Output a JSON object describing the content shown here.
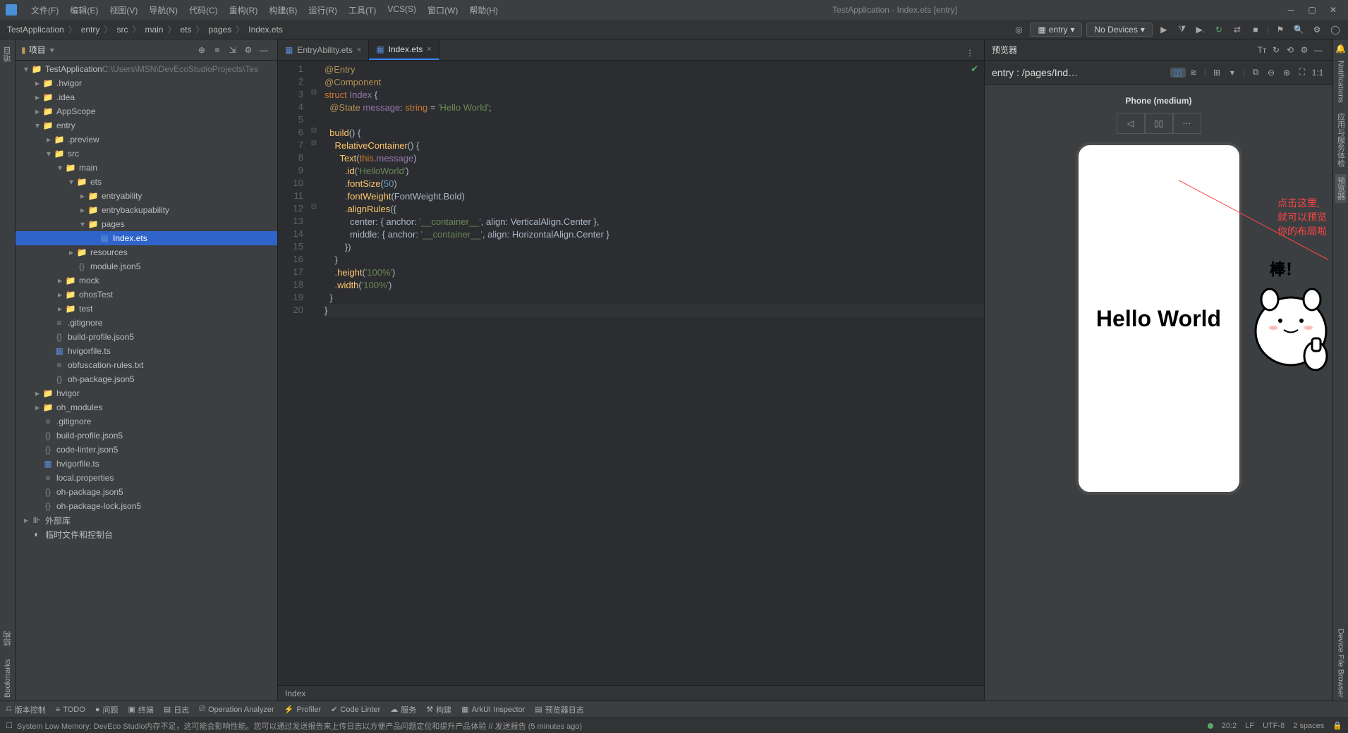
{
  "window": {
    "title": "TestApplication - Index.ets [entry]"
  },
  "menus": [
    "文件(F)",
    "编辑(E)",
    "视图(V)",
    "导航(N)",
    "代码(C)",
    "重构(R)",
    "构建(B)",
    "运行(R)",
    "工具(T)",
    "VCS(S)",
    "窗口(W)",
    "帮助(H)"
  ],
  "breadcrumbs": [
    "TestApplication",
    "entry",
    "src",
    "main",
    "ets",
    "pages",
    "Index.ets"
  ],
  "runconfig": {
    "module": "entry",
    "device": "No Devices"
  },
  "projectPanel": {
    "title": "项目"
  },
  "left_tabs": [
    "项目",
    "结构",
    "Bookmarks"
  ],
  "right_tabs": [
    "Notifications",
    "应用与服务体检",
    "预览器",
    "Device File Browser"
  ],
  "tree": [
    {
      "d": 0,
      "exp": "v",
      "icon": "folder-blue",
      "label": "TestApplication",
      "extra": "C:\\Users\\MSN\\DevEcoStudioProjects\\Tes"
    },
    {
      "d": 1,
      "exp": ">",
      "icon": "folder",
      "label": ".hvigor"
    },
    {
      "d": 1,
      "exp": ">",
      "icon": "folder",
      "label": ".idea"
    },
    {
      "d": 1,
      "exp": ">",
      "icon": "folder",
      "label": "AppScope"
    },
    {
      "d": 1,
      "exp": "v",
      "icon": "folder-blue",
      "label": "entry"
    },
    {
      "d": 2,
      "exp": ">",
      "icon": "folder",
      "label": ".preview"
    },
    {
      "d": 2,
      "exp": "v",
      "icon": "folder",
      "label": "src"
    },
    {
      "d": 3,
      "exp": "v",
      "icon": "folder",
      "label": "main"
    },
    {
      "d": 4,
      "exp": "v",
      "icon": "folder",
      "label": "ets"
    },
    {
      "d": 5,
      "exp": ">",
      "icon": "folder",
      "label": "entryability"
    },
    {
      "d": 5,
      "exp": ">",
      "icon": "folder",
      "label": "entrybackupability"
    },
    {
      "d": 5,
      "exp": "v",
      "icon": "folder",
      "label": "pages"
    },
    {
      "d": 6,
      "exp": "",
      "icon": "file-ets",
      "label": "Index.ets",
      "sel": true
    },
    {
      "d": 4,
      "exp": ">",
      "icon": "folder",
      "label": "resources"
    },
    {
      "d": 4,
      "exp": "",
      "icon": "file-json",
      "label": "module.json5"
    },
    {
      "d": 3,
      "exp": ">",
      "icon": "folder",
      "label": "mock"
    },
    {
      "d": 3,
      "exp": ">",
      "icon": "folder",
      "label": "ohosTest"
    },
    {
      "d": 3,
      "exp": ">",
      "icon": "folder",
      "label": "test"
    },
    {
      "d": 2,
      "exp": "",
      "icon": "file-txt",
      "label": ".gitignore"
    },
    {
      "d": 2,
      "exp": "",
      "icon": "file-json",
      "label": "build-profile.json5"
    },
    {
      "d": 2,
      "exp": "",
      "icon": "file-ets",
      "label": "hvigorfile.ts"
    },
    {
      "d": 2,
      "exp": "",
      "icon": "file-txt",
      "label": "obfuscation-rules.txt"
    },
    {
      "d": 2,
      "exp": "",
      "icon": "file-json",
      "label": "oh-package.json5"
    },
    {
      "d": 1,
      "exp": ">",
      "icon": "folder",
      "label": "hvigor"
    },
    {
      "d": 1,
      "exp": ">",
      "icon": "folder",
      "label": "oh_modules"
    },
    {
      "d": 1,
      "exp": "",
      "icon": "file-txt",
      "label": ".gitignore"
    },
    {
      "d": 1,
      "exp": "",
      "icon": "file-json",
      "label": "build-profile.json5"
    },
    {
      "d": 1,
      "exp": "",
      "icon": "file-json",
      "label": "code-linter.json5"
    },
    {
      "d": 1,
      "exp": "",
      "icon": "file-ets",
      "label": "hvigorfile.ts"
    },
    {
      "d": 1,
      "exp": "",
      "icon": "file-txt",
      "label": "local.properties"
    },
    {
      "d": 1,
      "exp": "",
      "icon": "file-json",
      "label": "oh-package.json5"
    },
    {
      "d": 1,
      "exp": "",
      "icon": "file-json",
      "label": "oh-package-lock.json5"
    },
    {
      "d": 0,
      "exp": ">",
      "icon": "lib",
      "label": "外部库"
    },
    {
      "d": 0,
      "exp": "",
      "icon": "scratch",
      "label": "临时文件和控制台"
    }
  ],
  "editor_tabs": [
    {
      "name": "EntryAbility.ets",
      "icon": "file-ets",
      "active": false
    },
    {
      "name": "Index.ets",
      "icon": "file-ets",
      "active": true
    }
  ],
  "code_lines": [
    [
      {
        "c": "k-dec",
        "t": "@Entry"
      }
    ],
    [
      {
        "c": "k-dec",
        "t": "@Component"
      }
    ],
    [
      {
        "c": "k-kw",
        "t": "struct "
      },
      {
        "c": "k-ident",
        "t": "Index"
      },
      {
        "c": "k-plain",
        "t": " {"
      }
    ],
    [
      {
        "c": "k-plain",
        "t": "  "
      },
      {
        "c": "k-dec",
        "t": "@State"
      },
      {
        "c": "k-plain",
        "t": " "
      },
      {
        "c": "k-ident",
        "t": "message"
      },
      {
        "c": "k-plain",
        "t": ": "
      },
      {
        "c": "k-type",
        "t": "string"
      },
      {
        "c": "k-plain",
        "t": " = "
      },
      {
        "c": "k-str",
        "t": "'Hello World'"
      },
      {
        "c": "k-plain",
        "t": ";"
      }
    ],
    [
      {
        "c": "k-plain",
        "t": ""
      }
    ],
    [
      {
        "c": "k-plain",
        "t": "  "
      },
      {
        "c": "k-func",
        "t": "build"
      },
      {
        "c": "k-plain",
        "t": "() {"
      }
    ],
    [
      {
        "c": "k-plain",
        "t": "    "
      },
      {
        "c": "k-func",
        "t": "RelativeContainer"
      },
      {
        "c": "k-plain",
        "t": "() {"
      }
    ],
    [
      {
        "c": "k-plain",
        "t": "      "
      },
      {
        "c": "k-func",
        "t": "Text"
      },
      {
        "c": "k-plain",
        "t": "("
      },
      {
        "c": "k-kw",
        "t": "this"
      },
      {
        "c": "k-plain",
        "t": "."
      },
      {
        "c": "k-ident",
        "t": "message"
      },
      {
        "c": "k-plain",
        "t": ")"
      }
    ],
    [
      {
        "c": "k-plain",
        "t": "        ."
      },
      {
        "c": "k-func",
        "t": "id"
      },
      {
        "c": "k-plain",
        "t": "("
      },
      {
        "c": "k-str",
        "t": "'HelloWorld'"
      },
      {
        "c": "k-plain",
        "t": ")"
      }
    ],
    [
      {
        "c": "k-plain",
        "t": "        ."
      },
      {
        "c": "k-func",
        "t": "fontSize"
      },
      {
        "c": "k-plain",
        "t": "("
      },
      {
        "c": "k-num",
        "t": "50"
      },
      {
        "c": "k-plain",
        "t": ")"
      }
    ],
    [
      {
        "c": "k-plain",
        "t": "        ."
      },
      {
        "c": "k-func",
        "t": "fontWeight"
      },
      {
        "c": "k-plain",
        "t": "(FontWeight.Bold)"
      }
    ],
    [
      {
        "c": "k-plain",
        "t": "        ."
      },
      {
        "c": "k-func",
        "t": "alignRules"
      },
      {
        "c": "k-plain",
        "t": "({"
      }
    ],
    [
      {
        "c": "k-plain",
        "t": "          center: { anchor: "
      },
      {
        "c": "k-str",
        "t": "'__container__'"
      },
      {
        "c": "k-plain",
        "t": ", align: VerticalAlign.Center },"
      }
    ],
    [
      {
        "c": "k-plain",
        "t": "          middle: { anchor: "
      },
      {
        "c": "k-str",
        "t": "'__container__'"
      },
      {
        "c": "k-plain",
        "t": ", align: HorizontalAlign.Center }"
      }
    ],
    [
      {
        "c": "k-plain",
        "t": "        })"
      }
    ],
    [
      {
        "c": "k-plain",
        "t": "    }"
      }
    ],
    [
      {
        "c": "k-plain",
        "t": "    ."
      },
      {
        "c": "k-func",
        "t": "height"
      },
      {
        "c": "k-plain",
        "t": "("
      },
      {
        "c": "k-str",
        "t": "'100%'"
      },
      {
        "c": "k-plain",
        "t": ")"
      }
    ],
    [
      {
        "c": "k-plain",
        "t": "    ."
      },
      {
        "c": "k-func",
        "t": "width"
      },
      {
        "c": "k-plain",
        "t": "("
      },
      {
        "c": "k-str",
        "t": "'100%'"
      },
      {
        "c": "k-plain",
        "t": ")"
      }
    ],
    [
      {
        "c": "k-plain",
        "t": "  }"
      }
    ],
    [
      {
        "c": "k-plain",
        "t": "}"
      }
    ]
  ],
  "code_crumb": "Index",
  "preview": {
    "title": "预览器",
    "path": "entry : /pages/Ind…",
    "device": "Phone (medium)",
    "text": "Hello World",
    "zoom": "1:1"
  },
  "annotation": {
    "l1": "点击这里,",
    "l2": "就可以预览",
    "l3": "你的布局啦",
    "bubble": "棒！"
  },
  "bottom_tools": [
    "版本控制",
    "TODO",
    "问题",
    "终端",
    "日志",
    "Operation Analyzer",
    "Profiler",
    "Code Linter",
    "服务",
    "构建",
    "ArkUI Inspector",
    "预览器日志"
  ],
  "status": {
    "msg": "System Low Memory: DevEco Studio内存不足，这可能会影响性能。您可以通过发送报告来上传日志以方便产品问题定位和提升产品体验 // 发送报告 (5 minutes ago)",
    "pos": "20:2",
    "lf": "LF",
    "enc": "UTF-8",
    "indent": "2 spaces"
  }
}
